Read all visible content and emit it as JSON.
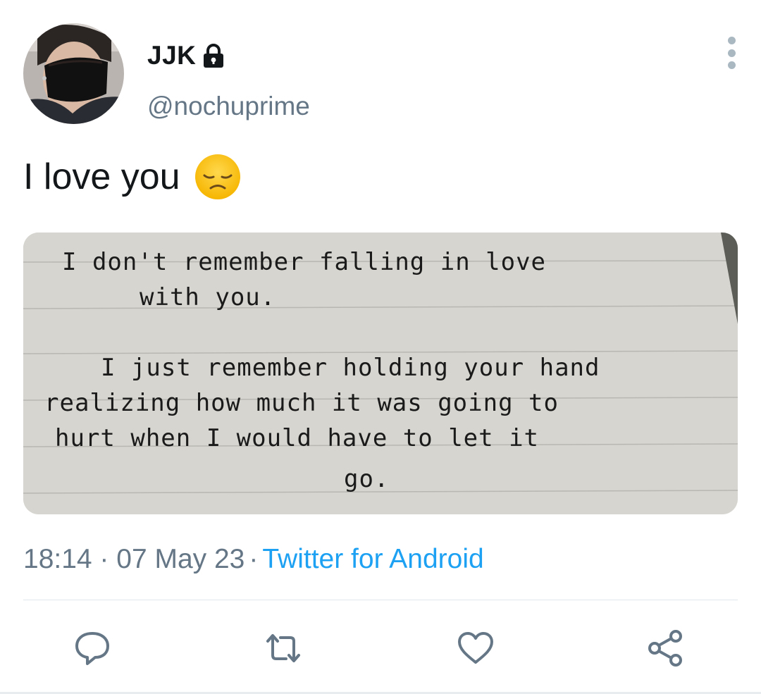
{
  "tweet": {
    "display_name": "JJK",
    "handle": "@nochuprime",
    "text": "I love you",
    "timestamp": "18:14 · 07 May 23",
    "separator": "·",
    "source": "Twitter for Android",
    "protected_icon": "lock-icon",
    "emoji": "disappointed-face-emoji",
    "media": {
      "lines": [
        "I don't remember falling in love",
        "with you.",
        "I just remember holding your hand",
        "realizing how much it was going to",
        "hurt when I would have to let it",
        "go."
      ]
    }
  },
  "actions": {
    "reply_icon": "reply-icon",
    "retweet_icon": "retweet-icon",
    "like_icon": "heart-icon",
    "share_icon": "share-icon"
  },
  "colors": {
    "text_primary": "#14171a",
    "text_secondary": "#657786",
    "link": "#1da1f2",
    "icon": "#657786"
  }
}
